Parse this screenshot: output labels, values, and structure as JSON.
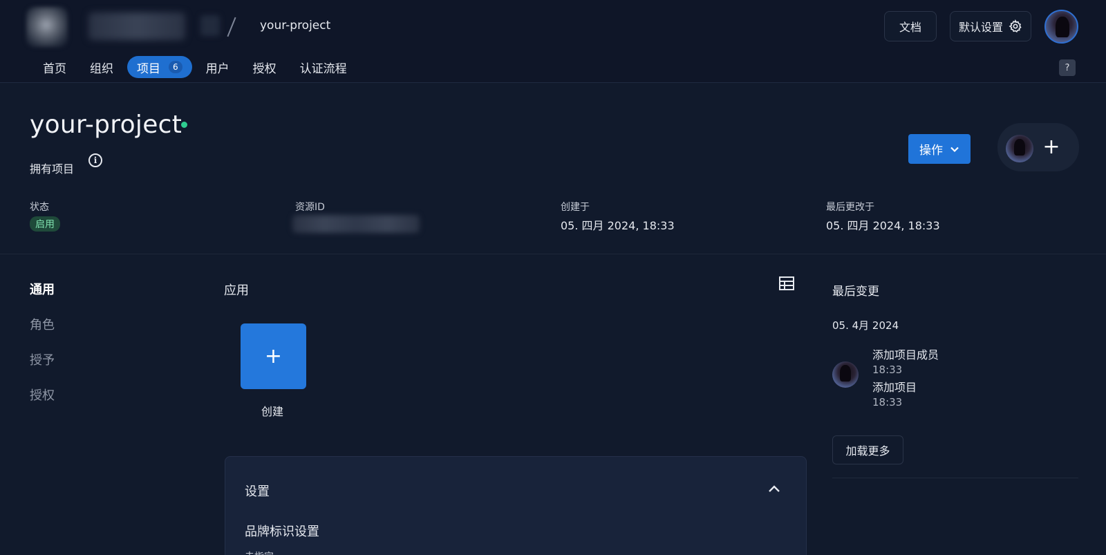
{
  "header": {
    "breadcrumb_project": "your-project",
    "docs_label": "文档",
    "settings_label": "默认设置"
  },
  "nav": {
    "items": [
      {
        "label": "首页"
      },
      {
        "label": "组织"
      },
      {
        "label": "项目",
        "count": "6"
      },
      {
        "label": "用户"
      },
      {
        "label": "授权"
      },
      {
        "label": "认证流程"
      }
    ],
    "help_label": "?"
  },
  "project": {
    "title": "your-project",
    "owned_label": "拥有项目",
    "info_glyph": "i",
    "actions_label": "操作",
    "members_add_glyph": "+"
  },
  "meta": {
    "state_label": "状态",
    "state_value": "启用",
    "resource_id_label": "资源ID",
    "created_label": "创建于",
    "created_value": "05. 四月 2024, 18:33",
    "modified_label": "最后更改于",
    "modified_value": "05. 四月 2024, 18:33"
  },
  "subnav": {
    "items": [
      {
        "label": "通用"
      },
      {
        "label": "角色"
      },
      {
        "label": "授予"
      },
      {
        "label": "授权"
      }
    ]
  },
  "apps": {
    "title": "应用",
    "create_glyph": "+",
    "create_label": "创建"
  },
  "settings": {
    "title": "设置",
    "branding_title": "品牌标识设置",
    "branding_sub": "未指定"
  },
  "changes": {
    "title": "最后变更",
    "date": "05. 4月 2024",
    "items": [
      {
        "text": "添加项目成员",
        "time": "18:33"
      },
      {
        "text": "添加项目",
        "time": "18:33"
      }
    ],
    "load_more_label": "加载更多"
  },
  "colors": {
    "background": "#111a2c",
    "accent": "#2074d9",
    "active_badge_bg": "#1f4a3a",
    "active_badge_text": "#7fe0ae",
    "status_dot": "#2ecc8f"
  },
  "icons": {
    "settings": "gear-icon",
    "actions_dropdown": "chevron-down-icon",
    "info": "info-icon",
    "table_view": "table-icon",
    "collapse": "chevron-up-icon"
  }
}
